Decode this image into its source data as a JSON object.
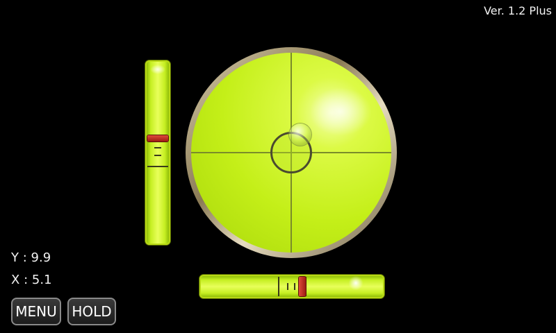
{
  "header": {
    "version": "Ver. 1.2 Plus"
  },
  "readouts": {
    "y_label": "Y",
    "y_value": "9.9",
    "x_label": "X",
    "x_value": "5.1",
    "separator": ":"
  },
  "buttons": {
    "menu": "MENU",
    "hold": "HOLD"
  },
  "levels": {
    "vertical_bubble_position": 0.42,
    "horizontal_bubble_position": 0.56,
    "circle_bubble_offset": {
      "x": 0.09,
      "y": -0.18
    }
  },
  "colors": {
    "liquid": "#c6ef22",
    "bubble_marker": "#c0392b",
    "background": "#000000"
  }
}
